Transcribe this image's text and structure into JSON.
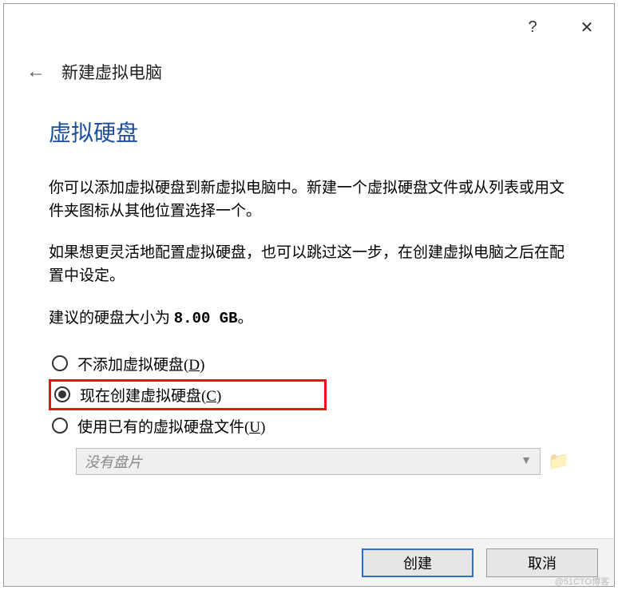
{
  "titlebar": {
    "help_icon": "?",
    "close_icon": "✕"
  },
  "header": {
    "back_icon": "←",
    "title": "新建虚拟电脑"
  },
  "section": {
    "title": "虚拟硬盘",
    "para1": "你可以添加虚拟硬盘到新虚拟电脑中。新建一个虚拟硬盘文件或从列表或用文件夹图标从其他位置选择一个。",
    "para2": "如果想更灵活地配置虚拟硬盘，也可以跳过这一步，在创建虚拟电脑之后在配置中设定。",
    "size_prefix": "建议的硬盘大小为 ",
    "size_value": "8.00 GB",
    "size_suffix": "。"
  },
  "options": [
    {
      "label_pre": "不添加虚拟硬盘(",
      "accel": "D",
      "label_post": ")",
      "checked": false,
      "highlight": false
    },
    {
      "label_pre": "现在创建虚拟硬盘(",
      "accel": "C",
      "label_post": ")",
      "checked": true,
      "highlight": true
    },
    {
      "label_pre": "使用已有的虚拟硬盘文件(",
      "accel": "U",
      "label_post": ")",
      "checked": false,
      "highlight": false
    }
  ],
  "combo": {
    "placeholder": "没有盘片",
    "chevron": "▼",
    "folder_icon": "📁"
  },
  "footer": {
    "create": "创建",
    "cancel": "取消"
  },
  "watermark": "@51CTO博客"
}
